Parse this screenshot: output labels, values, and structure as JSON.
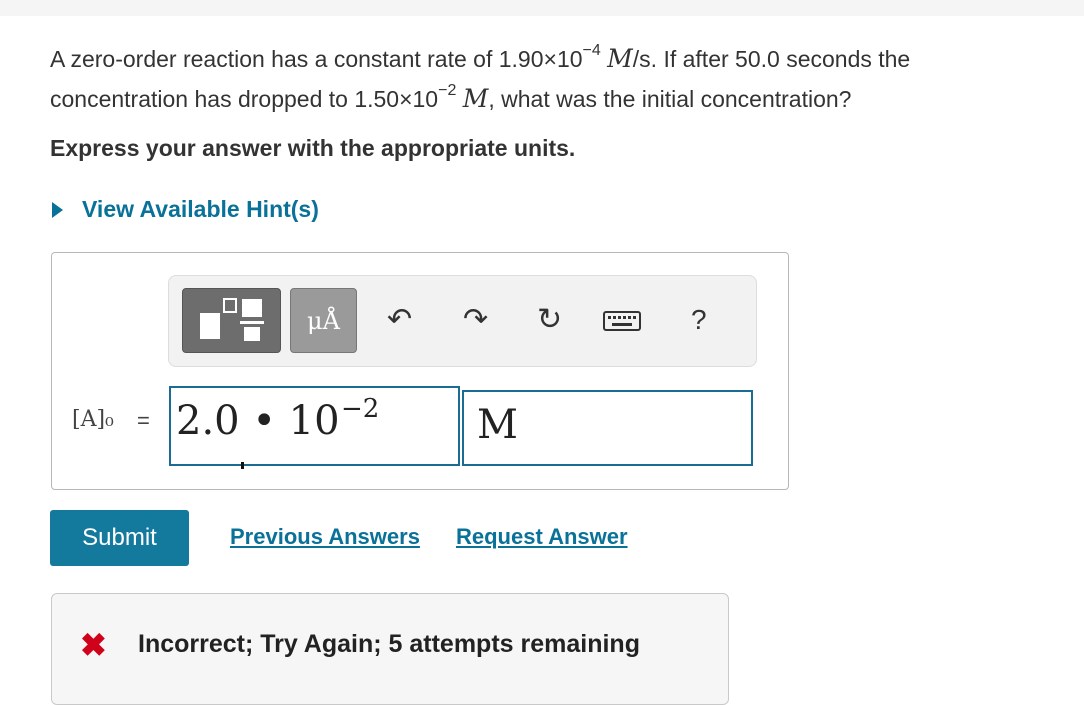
{
  "question": {
    "l1_before": "A zero-order reaction has a constant rate of 1.90×10",
    "l1_exp": "−4",
    "l1_unit": "M",
    "l1_after": "/s. If after 50.0 seconds the",
    "l2_before": "concentration has dropped to 1.50×10",
    "l2_exp": "−2",
    "l2_unit": "M",
    "l2_after": ", what was the initial concentration?"
  },
  "instruction": "Express your answer with the appropriate units.",
  "hint": {
    "label": "View Available Hint(s)"
  },
  "toolbar": {
    "units_label": "μÅ",
    "undo_icon": "↶",
    "redo_icon": "↷",
    "reset_icon": "↻",
    "help_label": "?"
  },
  "answer": {
    "label": "[A]₀",
    "equals": "=",
    "value": "2.0 • 10",
    "value_exp": "−2",
    "unit": "M"
  },
  "actions": {
    "submit": "Submit",
    "previous": "Previous Answers",
    "request": "Request Answer"
  },
  "feedback": {
    "icon": "✖",
    "text": "Incorrect; Try Again; 5 attempts remaining"
  },
  "colors": {
    "accent": "#137a9e",
    "link": "#0a7199",
    "error": "#d0021b"
  }
}
